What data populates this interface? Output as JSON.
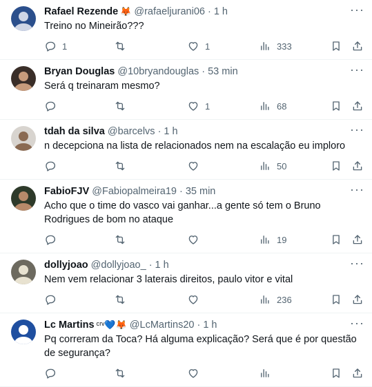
{
  "tweets": [
    {
      "name": "Rafael Rezende",
      "badge": "🦊",
      "handle": "@rafaeljurani06",
      "sep": "·",
      "time": "1 h",
      "text": "Treino no Mineirão???",
      "replies": "1",
      "retweets": "",
      "likes": "1",
      "views": "333",
      "avatar_colors": [
        "#2b4f8c",
        "#cfd6e6"
      ]
    },
    {
      "name": "Bryan Douglas",
      "badge": "",
      "handle": "@10bryandouglas",
      "sep": "·",
      "time": "53 min",
      "text": "Será q treinaram mesmo?",
      "replies": "",
      "retweets": "",
      "likes": "1",
      "views": "68",
      "avatar_colors": [
        "#3a2e28",
        "#c89c7c"
      ]
    },
    {
      "name": "tdah da silva",
      "badge": "",
      "handle": "@barcelvs",
      "sep": "·",
      "time": "1 h",
      "text": "n decepciona na lista de relacionados nem na escalação eu imploro",
      "replies": "",
      "retweets": "",
      "likes": "",
      "views": "50",
      "avatar_colors": [
        "#d8d4cf",
        "#8a6a52"
      ]
    },
    {
      "name": "FabioFJV",
      "badge": "",
      "handle": "@Fabiopalmeira19",
      "sep": "·",
      "time": "35 min",
      "text": "Acho que o time do vasco vai ganhar...a gente só tem o Bruno Rodrigues de bom no ataque",
      "replies": "",
      "retweets": "",
      "likes": "",
      "views": "19",
      "avatar_colors": [
        "#2e3a2a",
        "#b88a6a"
      ]
    },
    {
      "name": "dollyjoao",
      "badge": "",
      "handle": "@dollyjoao_",
      "sep": "·",
      "time": "1 h",
      "text": "Nem vem relacionar 3 laterais direitos, paulo vitor e vital",
      "replies": "",
      "retweets": "",
      "likes": "",
      "views": "236",
      "avatar_colors": [
        "#6d6a5f",
        "#e8e2d0"
      ]
    },
    {
      "name": "Lc Martins",
      "badge": "ᶜʳᵛ💙🦊",
      "handle": "@LcMartins20",
      "sep": "·",
      "time": "1 h",
      "text": "Pq correram da Toca? Há alguma explicação? Será que é por questão de segurança?",
      "replies": "",
      "retweets": "",
      "likes": "",
      "views": "",
      "avatar_colors": [
        "#1f4fa0",
        "#ffffff"
      ]
    }
  ],
  "icons": {
    "reply": "reply-icon",
    "retweet": "retweet-icon",
    "like": "heart-icon",
    "views": "views-icon",
    "bookmark": "bookmark-icon",
    "share": "share-icon",
    "more": "more-icon"
  },
  "colors": {
    "text": "#0f1419",
    "muted": "#536471",
    "divider": "#eff3f4"
  }
}
